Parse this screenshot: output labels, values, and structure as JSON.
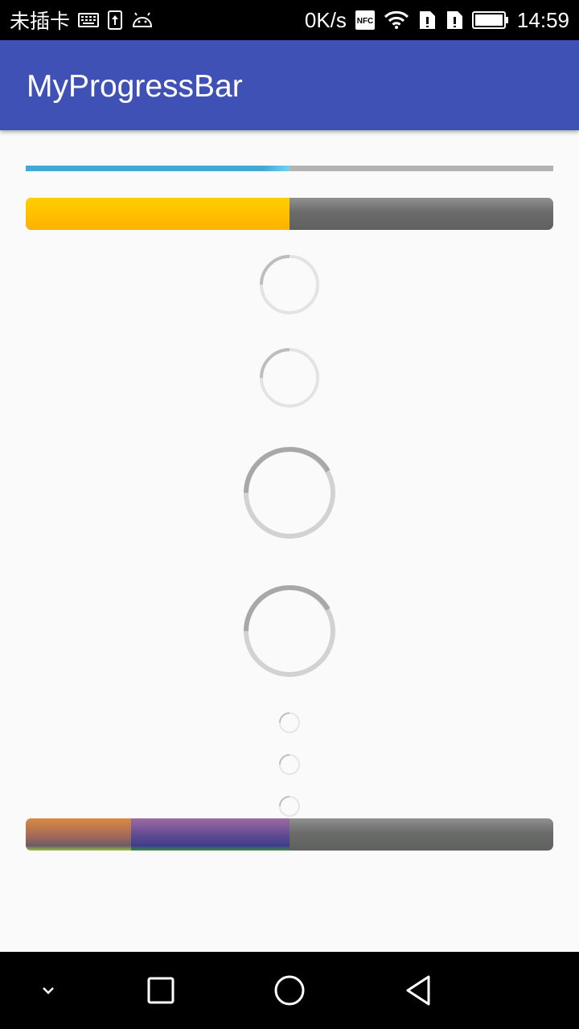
{
  "status_bar": {
    "carrier": "未插卡",
    "net_speed": "0K/s",
    "time": "14:59",
    "icons": [
      "keyboard-icon",
      "upload-icon",
      "android-icon",
      "nfc-icon",
      "wifi-icon",
      "sim-alert-icon",
      "sim-alert-icon",
      "battery-icon"
    ],
    "nfc_text": "NFC"
  },
  "app_bar": {
    "title": "MyProgressBar",
    "color": "#3f51b5"
  },
  "progress_bars": {
    "thin": {
      "progress": 0.5,
      "track_color": "#b3b3b3",
      "fill_color": "#44a8d4"
    },
    "yellow": {
      "progress": 0.5,
      "fill_color": "#ffc000"
    },
    "layered": {
      "progress": 0.2,
      "secondary_progress": 0.5
    }
  },
  "spinners": [
    {
      "name": "spinner-small-1"
    },
    {
      "name": "spinner-small-2"
    },
    {
      "name": "spinner-large-1"
    },
    {
      "name": "spinner-large-2"
    },
    {
      "name": "spinner-tiny-1"
    },
    {
      "name": "spinner-tiny-2"
    },
    {
      "name": "spinner-tiny-3"
    }
  ],
  "nav_bar": {
    "buttons": [
      "collapse-icon",
      "recents-icon",
      "home-icon",
      "back-icon"
    ]
  }
}
